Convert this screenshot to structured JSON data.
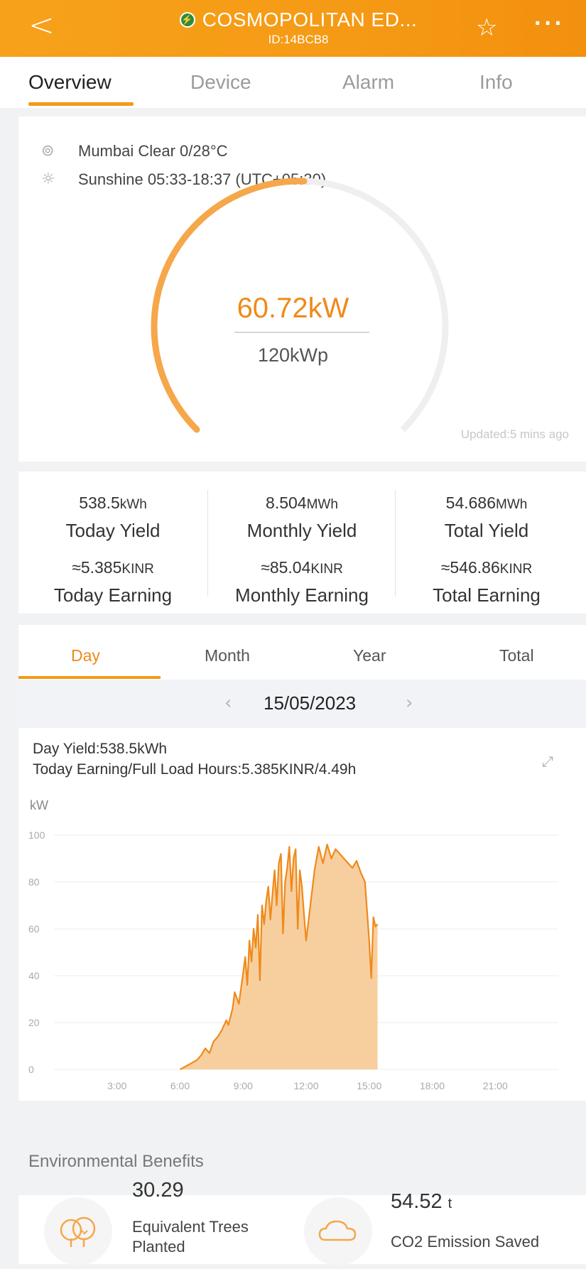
{
  "header": {
    "back_icon": "back-chevron-icon",
    "status_icon": "lightning-status-icon",
    "status_color": "#2e8b3e",
    "title": "COSMOPOLITAN ED...",
    "plant_id": "ID:14BCB8",
    "star_icon": "star-outline-icon",
    "more_icon": "more-dots-icon",
    "accent": "#f59a14"
  },
  "tabs": [
    "Overview",
    "Device",
    "Alarm",
    "Info"
  ],
  "active_tab": "Overview",
  "overview": {
    "weather": "Mumbai Clear 0/28°C",
    "sunshine": "Sunshine 05:33-18:37 (UTC+05:30)",
    "power": "60.72kW",
    "capacity": "120kWp",
    "gauge_fraction": 0.506,
    "updated": "Updated:5 mins ago"
  },
  "stats": {
    "today_yield": {
      "value": "538.5",
      "unit": "kWh",
      "label": "Today Yield"
    },
    "monthly_yield": {
      "value": "8.504",
      "unit": "MWh",
      "label": "Monthly Yield"
    },
    "total_yield": {
      "value": "54.686",
      "unit": "MWh",
      "label": "Total Yield"
    },
    "today_earning": {
      "value": "≈5.385",
      "unit": "KINR",
      "label": "Today Earning"
    },
    "monthly_earning": {
      "value": "≈85.04",
      "unit": "KINR",
      "label": "Monthly Earning"
    },
    "total_earning": {
      "value": "≈546.86",
      "unit": "KINR",
      "label": "Total Earning"
    }
  },
  "period_tabs": [
    "Day",
    "Month",
    "Year",
    "Total"
  ],
  "active_period": "Day",
  "date": "15/05/2023",
  "day_yield": "Day Yield:538.5kWh",
  "day_earning": "Today Earning/Full Load Hours:5.385KINR/4.49h",
  "chart_data": {
    "type": "area",
    "ylabel": "kW",
    "ylim": [
      0,
      100
    ],
    "yticks": [
      0,
      20,
      40,
      60,
      80,
      100
    ],
    "xticks": [
      "3:00",
      "6:00",
      "9:00",
      "12:00",
      "15:00",
      "18:00",
      "21:00"
    ],
    "xlim_hours": [
      0,
      24
    ],
    "grid": true,
    "color": "#ef8a1a",
    "fill": "#f7cf9f",
    "series": [
      {
        "x": [
          6.0,
          6.4,
          6.8,
          7.0,
          7.2,
          7.4,
          7.6,
          7.8,
          8.0,
          8.2,
          8.3,
          8.5,
          8.6,
          8.8,
          9.0,
          9.1,
          9.2,
          9.3,
          9.4,
          9.5,
          9.6,
          9.7,
          9.8,
          9.9,
          10.0,
          10.1,
          10.2,
          10.3,
          10.4,
          10.5,
          10.6,
          10.7,
          10.8,
          10.9,
          11.0,
          11.1,
          11.2,
          11.3,
          11.4,
          11.5,
          11.6,
          11.7,
          11.8,
          11.9,
          12.0,
          12.2,
          12.4,
          12.6,
          12.8,
          13.0,
          13.2,
          13.4,
          13.6,
          13.8,
          14.0,
          14.2,
          14.4,
          14.6,
          14.8,
          15.0,
          15.1,
          15.2,
          15.3,
          15.4
        ],
        "y": [
          0,
          2,
          4,
          6,
          9,
          7,
          12,
          14,
          17,
          21,
          19,
          26,
          33,
          28,
          41,
          48,
          36,
          55,
          46,
          60,
          52,
          66,
          38,
          70,
          62,
          72,
          78,
          64,
          75,
          85,
          70,
          88,
          92,
          58,
          80,
          86,
          95,
          76,
          90,
          94,
          60,
          85,
          78,
          66,
          55,
          70,
          85,
          95,
          88,
          96,
          90,
          94,
          92,
          90,
          88,
          86,
          89,
          84,
          80,
          55,
          39,
          65,
          61,
          62
        ]
      }
    ]
  },
  "environment": {
    "title": "Environmental Benefits",
    "trees_value": "30.29",
    "trees_label_1": "Equivalent Trees",
    "trees_label_2": "Planted",
    "trees_icon": "trees-icon",
    "co2_value": "54.52",
    "co2_unit": "t",
    "co2_label": "CO2 Emission Saved",
    "co2_icon": "cloud-icon"
  }
}
